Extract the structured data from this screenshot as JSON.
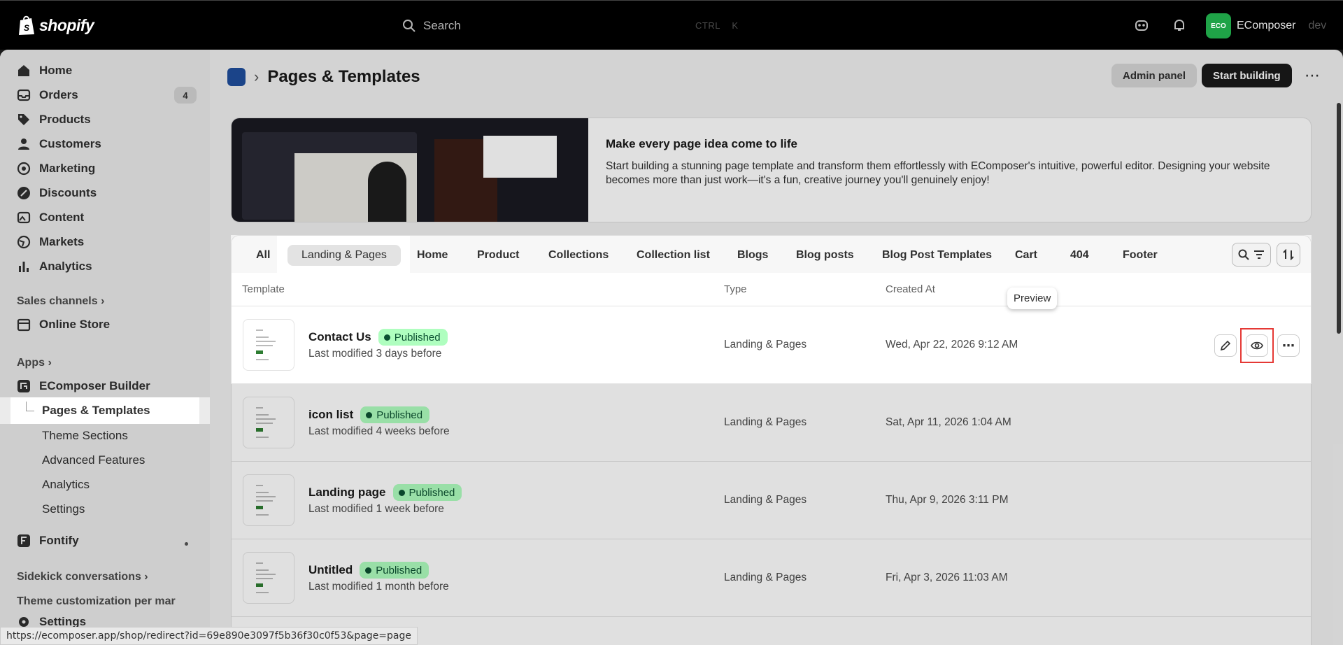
{
  "topbar": {
    "logo": "shopify",
    "search_placeholder": "Search",
    "shortcut_ctrl": "CTRL",
    "shortcut_k": "K",
    "store_initials": "ECO",
    "store_name": "EComposer",
    "store_suffix": "dev"
  },
  "sidebar": {
    "items": [
      {
        "label": "Home",
        "icon": "home-icon"
      },
      {
        "label": "Orders",
        "icon": "inbox-icon",
        "count": "4"
      },
      {
        "label": "Products",
        "icon": "tag-icon"
      },
      {
        "label": "Customers",
        "icon": "person-icon"
      },
      {
        "label": "Marketing",
        "icon": "target-icon"
      },
      {
        "label": "Discounts",
        "icon": "discount-icon"
      },
      {
        "label": "Content",
        "icon": "image-icon"
      },
      {
        "label": "Markets",
        "icon": "globe-icon"
      },
      {
        "label": "Analytics",
        "icon": "bar-chart-icon"
      }
    ],
    "sales_channels": "Sales channels",
    "online_store": "Online Store",
    "apps": "Apps",
    "app_name": "EComposer Builder",
    "app_subitems": [
      "Pages & Templates",
      "Theme Sections",
      "Advanced Features",
      "Analytics",
      "Settings"
    ],
    "fontify": "Fontify",
    "sidekick": "Sidekick conversations",
    "theme_custom": "Theme customization per mar",
    "settings": "Settings"
  },
  "header": {
    "title": "Pages & Templates",
    "admin_panel": "Admin panel",
    "start_building": "Start building"
  },
  "banner": {
    "title": "Make every page idea come to life",
    "description": "Start building a stunning page template and transform them effortlessly with EComposer's intuitive, powerful editor. Designing your website becomes more than just work—it's a fun, creative journey you'll genuinely enjoy!"
  },
  "tabs": [
    "All",
    "Landing & Pages",
    "Home",
    "Product",
    "Collections",
    "Collection list",
    "Blogs",
    "Blog posts",
    "Blog Post Templates",
    "Cart",
    "404",
    "Footer"
  ],
  "selected_tab": "Landing & Pages",
  "table": {
    "columns": [
      "Template",
      "Type",
      "Created At"
    ],
    "rows": [
      {
        "name": "Contact Us",
        "status": "Published",
        "modified": "Last modified 3 days before",
        "type": "Landing & Pages",
        "created": "Wed, Apr 22, 2026 9:12 AM"
      },
      {
        "name": "icon list",
        "status": "Published",
        "modified": "Last modified 4 weeks before",
        "type": "Landing & Pages",
        "created": "Sat, Apr 11, 2026 1:04 AM"
      },
      {
        "name": "Landing page",
        "status": "Published",
        "modified": "Last modified 1 week before",
        "type": "Landing & Pages",
        "created": "Thu, Apr 9, 2026 3:11 PM"
      },
      {
        "name": "Untitled",
        "status": "Published",
        "modified": "Last modified 1 month before",
        "type": "Landing & Pages",
        "created": "Fri, Apr 3, 2026 11:03 AM"
      }
    ]
  },
  "tooltip": "Preview",
  "status_url": "https://ecomposer.app/shop/redirect?id=69e890e3097f5b36f30c0f53&page=page",
  "colors": {
    "accent": "#1a1a1a",
    "published_bg": "#affebf",
    "highlight": "#e53935"
  }
}
